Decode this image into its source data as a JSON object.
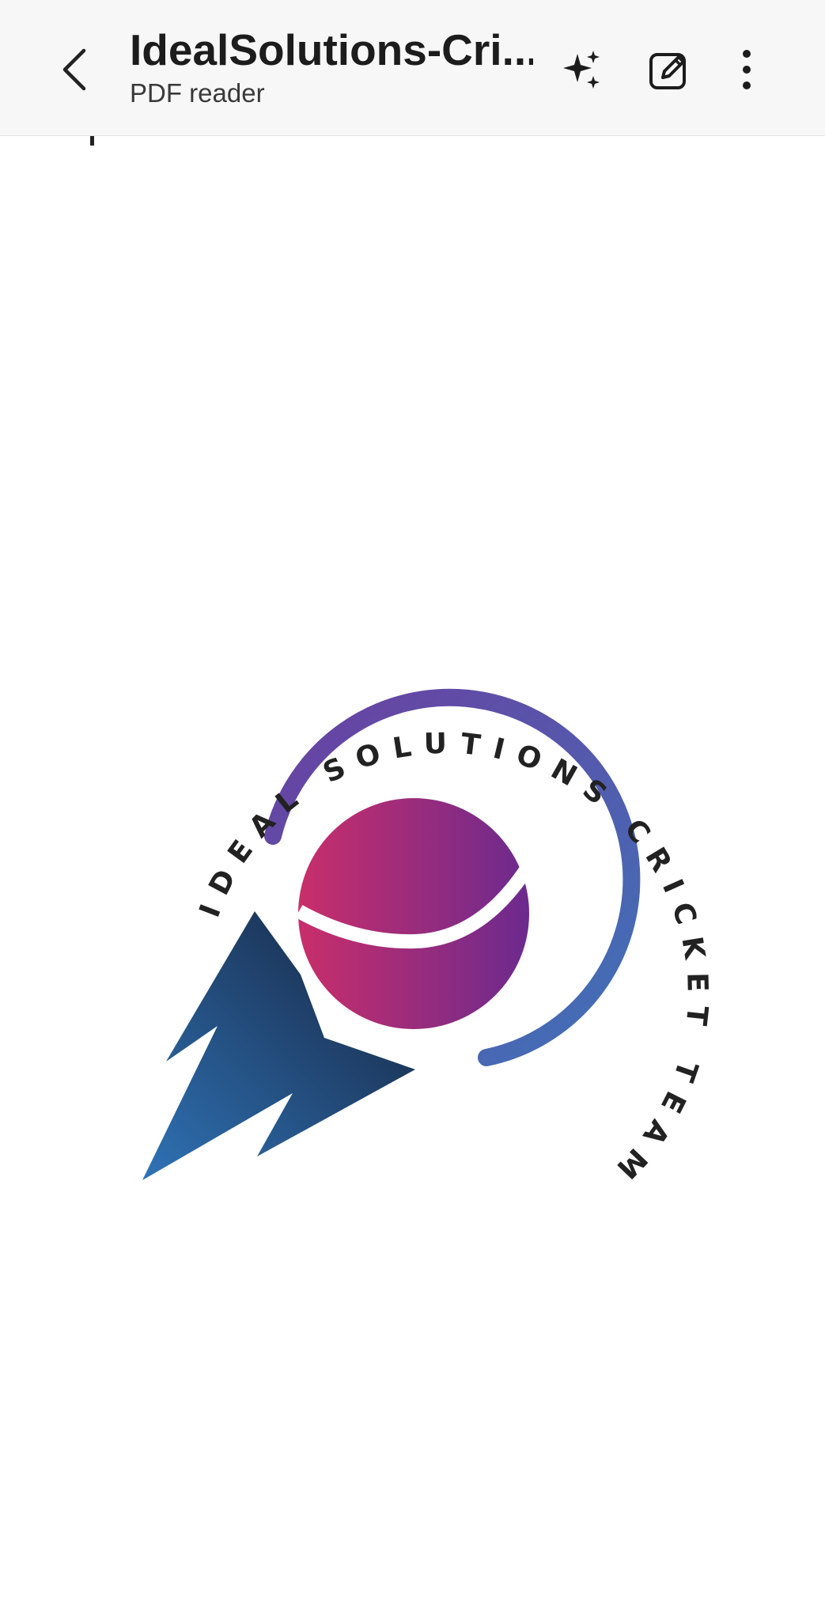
{
  "header": {
    "title": "IdealSolutions-Cri...",
    "subtitle": "PDF reader",
    "icons": {
      "back": "back-arrow-icon",
      "ai": "sparkle-ai-icon",
      "edit": "edit-pen-icon",
      "more": "more-vertical-icon"
    }
  },
  "document": {
    "logo": {
      "ring_text": "IDEAL SOLUTIONS CRICKET TEAM",
      "colors": {
        "ball_start": "#c92e6a",
        "ball_end": "#6c2a8e",
        "arc_start": "#6b3fa0",
        "arc_end": "#3f72b8",
        "flame_start": "#2f73b6",
        "flame_end": "#15213a",
        "text": "#222222"
      }
    }
  }
}
